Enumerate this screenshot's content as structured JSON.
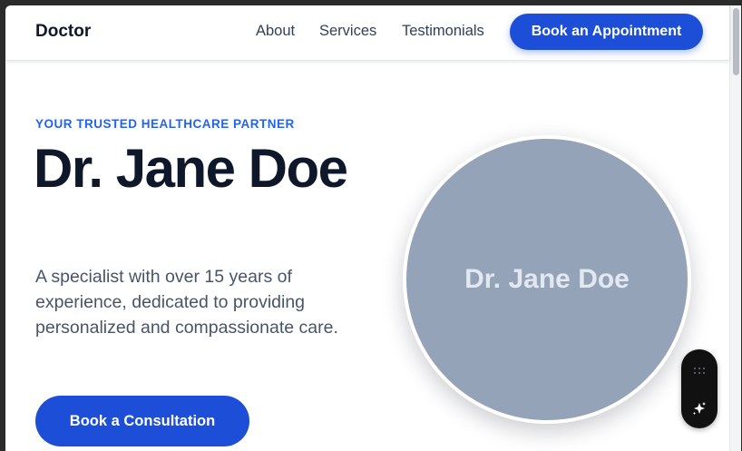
{
  "header": {
    "brand": "Doctor",
    "nav": [
      "About",
      "Services",
      "Testimonials"
    ],
    "cta_label": "Book an Appointment"
  },
  "hero": {
    "tagline": "YOUR TRUSTED HEALTHCARE PARTNER",
    "title": "Dr. Jane Doe",
    "description": "A specialist with over 15 years of experience, dedicated to providing personalized and compassionate care.",
    "cta_label": "Book a Consultation",
    "portrait_label": "Dr. Jane Doe"
  },
  "widget": {
    "icons": [
      "drag-handle-icon",
      "sparkle-icon"
    ]
  },
  "colors": {
    "accent": "#1d4ed8",
    "tagline": "#2563eb",
    "heading": "#0f172a",
    "body_text": "#475569",
    "portrait_bg": "#94a3b8"
  }
}
